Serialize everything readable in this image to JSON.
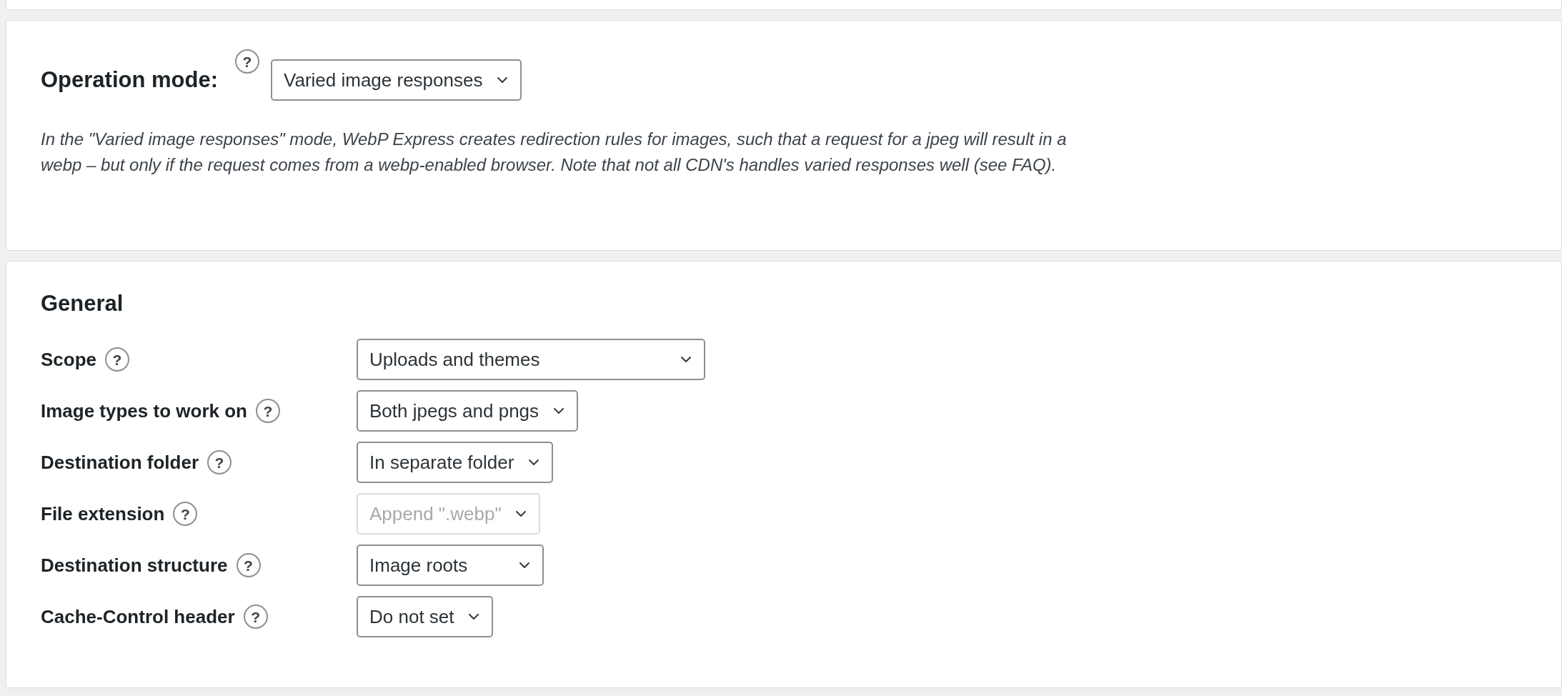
{
  "operation_mode": {
    "label": "Operation mode:",
    "help": "?",
    "select": {
      "value": "Varied image responses",
      "disabled": false
    },
    "description": "In the \"Varied image responses\" mode, WebP Express creates redirection rules for images, such that a request for a jpeg will result in a webp – but only if the request comes from a webp-enabled browser. Note that not all CDN's handles varied responses well (see FAQ)."
  },
  "general": {
    "title": "General",
    "settings": [
      {
        "label": "Scope",
        "help": "?",
        "value": "Uploads and themes",
        "disabled": false
      },
      {
        "label": "Image types to work on",
        "help": "?",
        "value": "Both jpegs and pngs",
        "disabled": false
      },
      {
        "label": "Destination folder",
        "help": "?",
        "value": "In separate folder",
        "disabled": false
      },
      {
        "label": "File extension",
        "help": "?",
        "value": "Append \".webp\"",
        "disabled": true
      },
      {
        "label": "Destination structure",
        "help": "?",
        "value": "Image roots",
        "disabled": false
      },
      {
        "label": "Cache-Control header",
        "help": "?",
        "value": "Do not set",
        "disabled": false
      }
    ]
  }
}
